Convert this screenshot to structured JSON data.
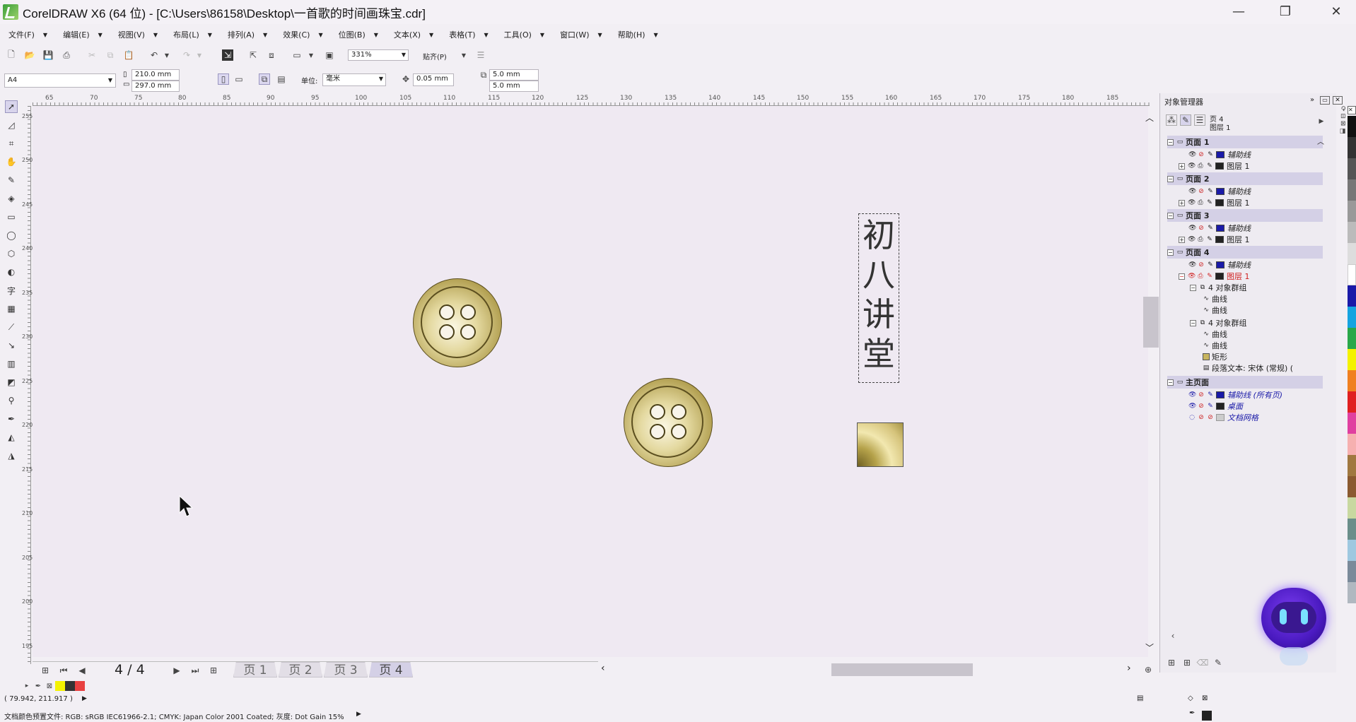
{
  "window": {
    "title": "CorelDRAW X6 (64 位) - [C:\\Users\\86158\\Desktop\\一首歌的时间画珠宝.cdr]",
    "min": "—",
    "restore": "❐",
    "close": "✕"
  },
  "menu": [
    "文件(F)",
    "编辑(E)",
    "视图(V)",
    "布局(L)",
    "排列(A)",
    "效果(C)",
    "位图(B)",
    "文本(X)",
    "表格(T)",
    "工具(O)",
    "窗口(W)",
    "帮助(H)"
  ],
  "toolbar1": {
    "zoom": "331%",
    "snap": "贴齐(P)"
  },
  "toolbar2": {
    "page_size": "A4",
    "width": "210.0 mm",
    "height": "297.0 mm",
    "unit_label": "单位:",
    "unit": "毫米",
    "nudge": "0.05 mm",
    "dup_x": "5.0 mm",
    "dup_y": "5.0 mm"
  },
  "hruler": [
    "65",
    "70",
    "75",
    "80",
    "85",
    "90",
    "95",
    "100",
    "105",
    "110",
    "115",
    "120",
    "125",
    "130",
    "135",
    "140",
    "145",
    "150",
    "155",
    "160",
    "165",
    "170",
    "175",
    "180",
    "185"
  ],
  "vruler": [
    "255",
    "250",
    "245",
    "240",
    "235",
    "230",
    "225",
    "220",
    "215",
    "210",
    "205",
    "200",
    "195"
  ],
  "canvas": {
    "vertical_text": [
      "初",
      "八",
      "讲",
      "堂"
    ]
  },
  "pagebar": {
    "counter": "4 / 4",
    "tabs": [
      "页 1",
      "页 2",
      "页 3",
      "页 4"
    ]
  },
  "coords": "( 79.942, 211.917 )",
  "status": "文档颜色预置文件: RGB: sRGB IEC61966-2.1; CMYK: Japan Color 2001 Coated; 灰度: Dot Gain 15%",
  "object_manager": {
    "title": "对象管理器",
    "current_page": "页 4",
    "current_layer": "图层 1",
    "rows": [
      {
        "kind": "page",
        "label": "页面 1"
      },
      {
        "kind": "guide",
        "label": "辅助线"
      },
      {
        "kind": "layer",
        "label": "图层 1"
      },
      {
        "kind": "page",
        "label": "页面 2"
      },
      {
        "kind": "guide",
        "label": "辅助线"
      },
      {
        "kind": "layer",
        "label": "图层 1"
      },
      {
        "kind": "page",
        "label": "页面 3"
      },
      {
        "kind": "guide",
        "label": "辅助线"
      },
      {
        "kind": "layer",
        "label": "图层 1"
      },
      {
        "kind": "page",
        "label": "页面 4"
      },
      {
        "kind": "guide",
        "label": "辅助线"
      },
      {
        "kind": "layer-active",
        "label": "图层 1"
      },
      {
        "kind": "group",
        "label": "4 对象群组"
      },
      {
        "kind": "curve",
        "label": "曲线"
      },
      {
        "kind": "curve",
        "label": "曲线"
      },
      {
        "kind": "group",
        "label": "4 对象群组"
      },
      {
        "kind": "curve",
        "label": "曲线"
      },
      {
        "kind": "curve",
        "label": "曲线"
      },
      {
        "kind": "rect",
        "label": "矩形"
      },
      {
        "kind": "text",
        "label": "段落文本: 宋体 (常规) ("
      },
      {
        "kind": "page",
        "label": "主页面"
      },
      {
        "kind": "guide",
        "label": "辅助线 (所有页)"
      },
      {
        "kind": "desktop",
        "label": "桌面"
      },
      {
        "kind": "grid",
        "label": "文档网格"
      }
    ]
  },
  "colors": {
    "accent": "#1a1aa8",
    "gold": "#c8b560",
    "active_layer": "#d02020"
  }
}
